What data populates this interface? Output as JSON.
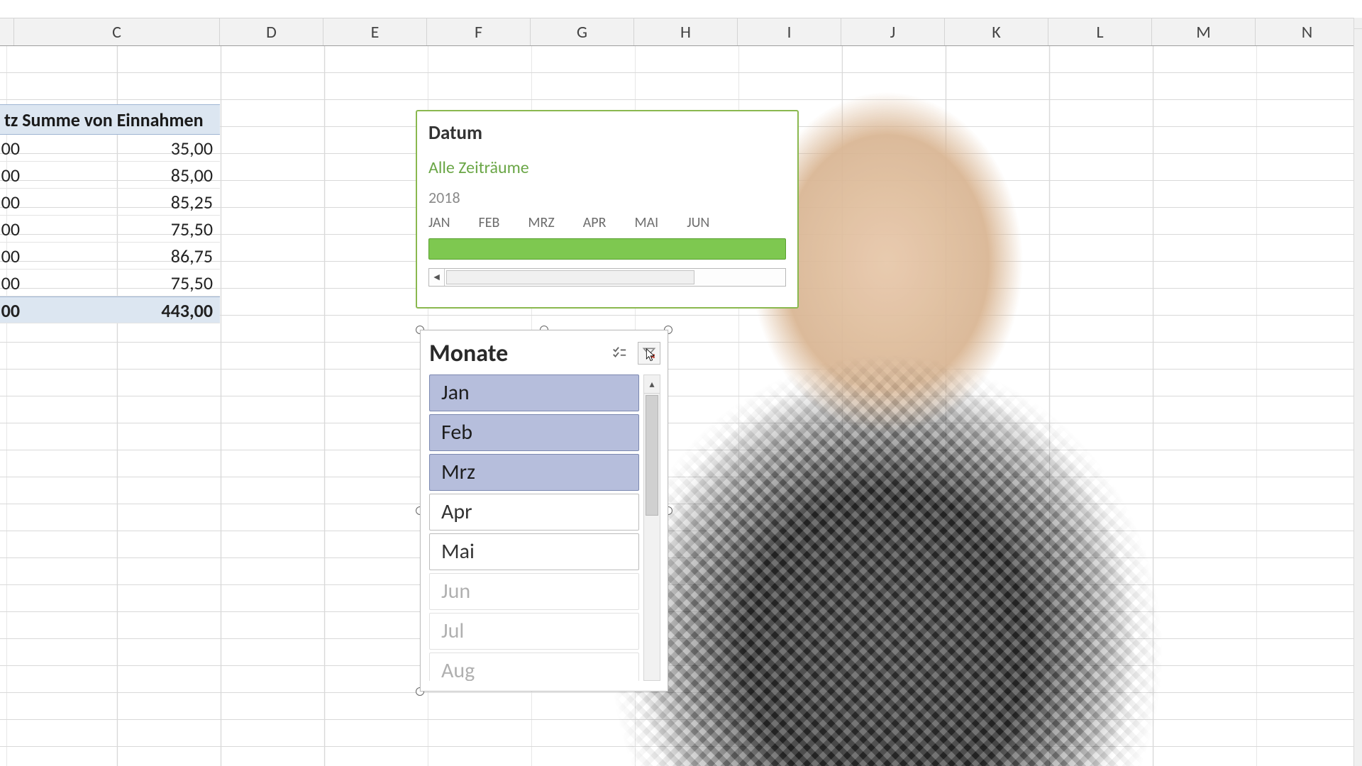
{
  "columns": [
    "C",
    "D",
    "E",
    "F",
    "G",
    "H",
    "I",
    "J",
    "K",
    "L",
    "M",
    "N"
  ],
  "pivot": {
    "header_fragment": "tz  Summe von Einnahmen",
    "left_fragment": "00",
    "rows": [
      "35,00",
      "85,00",
      "85,25",
      "75,50",
      "86,75",
      "75,50"
    ],
    "total": "443,00"
  },
  "timeline": {
    "title": "Datum",
    "subtitle": "Alle Zeiträume",
    "year": "2018",
    "months": [
      "JAN",
      "FEB",
      "MRZ",
      "APR",
      "MAI",
      "JUN"
    ]
  },
  "slicer": {
    "title": "Monate",
    "items": [
      {
        "label": "Jan",
        "state": "sel"
      },
      {
        "label": "Feb",
        "state": "sel"
      },
      {
        "label": "Mrz",
        "state": "sel"
      },
      {
        "label": "Apr",
        "state": "norm"
      },
      {
        "label": "Mai",
        "state": "norm"
      },
      {
        "label": "Jun",
        "state": "dim"
      },
      {
        "label": "Jul",
        "state": "dim"
      },
      {
        "label": "Aug",
        "state": "dim"
      }
    ]
  }
}
